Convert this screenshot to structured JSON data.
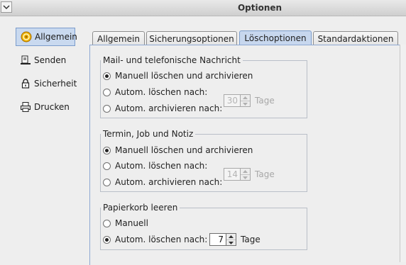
{
  "window": {
    "title": "Optionen"
  },
  "sidebar": {
    "items": [
      {
        "label": "Allgemein",
        "icon": "general-settings-icon",
        "active": true
      },
      {
        "label": "Senden",
        "icon": "send-icon",
        "active": false
      },
      {
        "label": "Sicherheit",
        "icon": "lock-icon",
        "active": false
      },
      {
        "label": "Drucken",
        "icon": "printer-icon",
        "active": false
      }
    ]
  },
  "tabs": [
    {
      "label": "Allgemein",
      "active": false
    },
    {
      "label": "Sicherungsoptionen",
      "active": false
    },
    {
      "label": "Löschoptionen",
      "active": true
    },
    {
      "label": "Standardaktionen",
      "active": false
    }
  ],
  "groups": {
    "mail": {
      "title": "Mail- und telefonische Nachricht",
      "options": [
        {
          "label": "Manuell löschen und archivieren",
          "selected": true
        },
        {
          "label": "Autom. löschen nach:",
          "selected": false
        },
        {
          "label": "Autom. archivieren nach:",
          "selected": false
        }
      ],
      "days_value": "30",
      "days_unit": "Tage"
    },
    "termin": {
      "title": "Termin, Job und Notiz",
      "options": [
        {
          "label": "Manuell löschen und archivieren",
          "selected": true
        },
        {
          "label": "Autom. löschen nach:",
          "selected": false
        },
        {
          "label": "Autom. archivieren nach:",
          "selected": false
        }
      ],
      "days_value": "14",
      "days_unit": "Tage"
    },
    "papierkorb": {
      "title": "Papierkorb leeren",
      "options": [
        {
          "label": "Manuell",
          "selected": false
        },
        {
          "label": "Autom. löschen nach:",
          "selected": true
        }
      ],
      "days_value": "7",
      "days_unit": "Tage"
    }
  },
  "colors": {
    "accent": "#c7d7ee",
    "accent_border": "#7b9ccb",
    "background": "#eeeeee"
  }
}
